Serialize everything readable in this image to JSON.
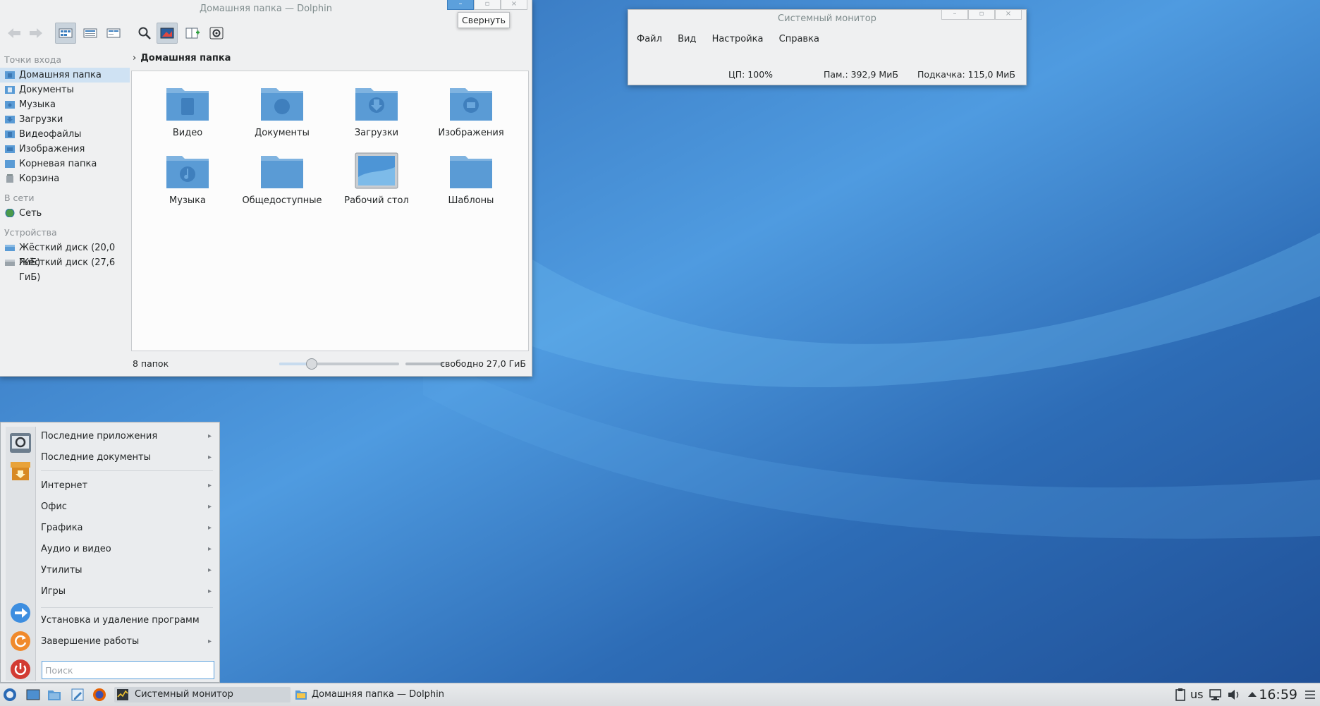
{
  "dolphin": {
    "title": "Домашняя папка — Dolphin",
    "tooltip": "Свернуть",
    "breadcrumb": "Домашняя папка",
    "places": {
      "sections": [
        {
          "header": "Точки входа",
          "items": [
            "Домашняя папка",
            "Документы",
            "Музыка",
            "Загрузки",
            "Видеофайлы",
            "Изображения",
            "Корневая папка",
            "Корзина"
          ]
        },
        {
          "header": "В сети",
          "items": [
            "Сеть"
          ]
        },
        {
          "header": "Устройства",
          "items": [
            "Жёсткий диск (20,0 ГиБ)",
            "Жёсткий диск (27,6 ГиБ)"
          ]
        }
      ]
    },
    "files": [
      "Видео",
      "Документы",
      "Загрузки",
      "Изображения",
      "Музыка",
      "Общедоступные",
      "Рабочий стол",
      "Шаблоны"
    ],
    "status": {
      "count": "8 папок",
      "free": "свободно 27,0 ГиБ",
      "zoom_fraction": 0.27
    }
  },
  "sysmon": {
    "title": "Системный монитор",
    "menu": [
      "Файл",
      "Вид",
      "Настройка",
      "Справка"
    ],
    "cpu": "ЦП: 100%",
    "mem": "Пам.: 392,9 МиБ",
    "swap": "Подкачка: 115,0 МиБ"
  },
  "startmenu": {
    "recent": [
      "Последние приложения",
      "Последние документы"
    ],
    "categories": [
      "Интернет",
      "Офис",
      "Графика",
      "Аудио и видео",
      "Утилиты",
      "Игры"
    ],
    "system": [
      "Установка и удаление программ",
      "Завершение работы"
    ],
    "search_placeholder": "Поиск"
  },
  "taskbar": {
    "tasks": [
      "Системный монитор",
      "Домашняя папка — Dolphin"
    ],
    "layout": "us",
    "clock": "16:59"
  },
  "colors": {
    "accent": "#5ca0dc",
    "wallpaper": "#2f6fb8",
    "selection": "#cfe2f3"
  }
}
